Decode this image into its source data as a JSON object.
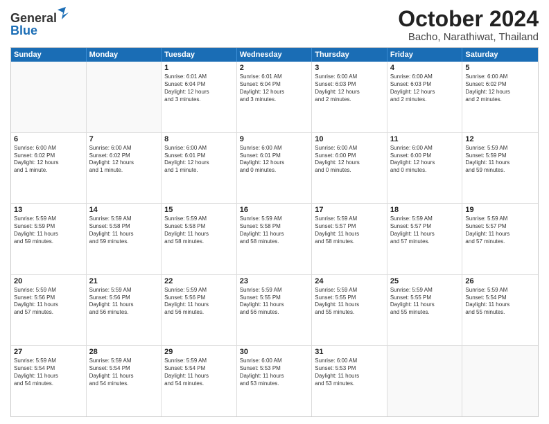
{
  "header": {
    "logo_general": "General",
    "logo_blue": "Blue",
    "title": "October 2024",
    "subtitle": "Bacho, Narathiwat, Thailand"
  },
  "days_of_week": [
    "Sunday",
    "Monday",
    "Tuesday",
    "Wednesday",
    "Thursday",
    "Friday",
    "Saturday"
  ],
  "weeks": [
    [
      {
        "day": "",
        "info": ""
      },
      {
        "day": "",
        "info": ""
      },
      {
        "day": "1",
        "info": "Sunrise: 6:01 AM\nSunset: 6:04 PM\nDaylight: 12 hours\nand 3 minutes."
      },
      {
        "day": "2",
        "info": "Sunrise: 6:01 AM\nSunset: 6:04 PM\nDaylight: 12 hours\nand 3 minutes."
      },
      {
        "day": "3",
        "info": "Sunrise: 6:00 AM\nSunset: 6:03 PM\nDaylight: 12 hours\nand 2 minutes."
      },
      {
        "day": "4",
        "info": "Sunrise: 6:00 AM\nSunset: 6:03 PM\nDaylight: 12 hours\nand 2 minutes."
      },
      {
        "day": "5",
        "info": "Sunrise: 6:00 AM\nSunset: 6:02 PM\nDaylight: 12 hours\nand 2 minutes."
      }
    ],
    [
      {
        "day": "6",
        "info": "Sunrise: 6:00 AM\nSunset: 6:02 PM\nDaylight: 12 hours\nand 1 minute."
      },
      {
        "day": "7",
        "info": "Sunrise: 6:00 AM\nSunset: 6:02 PM\nDaylight: 12 hours\nand 1 minute."
      },
      {
        "day": "8",
        "info": "Sunrise: 6:00 AM\nSunset: 6:01 PM\nDaylight: 12 hours\nand 1 minute."
      },
      {
        "day": "9",
        "info": "Sunrise: 6:00 AM\nSunset: 6:01 PM\nDaylight: 12 hours\nand 0 minutes."
      },
      {
        "day": "10",
        "info": "Sunrise: 6:00 AM\nSunset: 6:00 PM\nDaylight: 12 hours\nand 0 minutes."
      },
      {
        "day": "11",
        "info": "Sunrise: 6:00 AM\nSunset: 6:00 PM\nDaylight: 12 hours\nand 0 minutes."
      },
      {
        "day": "12",
        "info": "Sunrise: 5:59 AM\nSunset: 5:59 PM\nDaylight: 11 hours\nand 59 minutes."
      }
    ],
    [
      {
        "day": "13",
        "info": "Sunrise: 5:59 AM\nSunset: 5:59 PM\nDaylight: 11 hours\nand 59 minutes."
      },
      {
        "day": "14",
        "info": "Sunrise: 5:59 AM\nSunset: 5:58 PM\nDaylight: 11 hours\nand 59 minutes."
      },
      {
        "day": "15",
        "info": "Sunrise: 5:59 AM\nSunset: 5:58 PM\nDaylight: 11 hours\nand 58 minutes."
      },
      {
        "day": "16",
        "info": "Sunrise: 5:59 AM\nSunset: 5:58 PM\nDaylight: 11 hours\nand 58 minutes."
      },
      {
        "day": "17",
        "info": "Sunrise: 5:59 AM\nSunset: 5:57 PM\nDaylight: 11 hours\nand 58 minutes."
      },
      {
        "day": "18",
        "info": "Sunrise: 5:59 AM\nSunset: 5:57 PM\nDaylight: 11 hours\nand 57 minutes."
      },
      {
        "day": "19",
        "info": "Sunrise: 5:59 AM\nSunset: 5:57 PM\nDaylight: 11 hours\nand 57 minutes."
      }
    ],
    [
      {
        "day": "20",
        "info": "Sunrise: 5:59 AM\nSunset: 5:56 PM\nDaylight: 11 hours\nand 57 minutes."
      },
      {
        "day": "21",
        "info": "Sunrise: 5:59 AM\nSunset: 5:56 PM\nDaylight: 11 hours\nand 56 minutes."
      },
      {
        "day": "22",
        "info": "Sunrise: 5:59 AM\nSunset: 5:56 PM\nDaylight: 11 hours\nand 56 minutes."
      },
      {
        "day": "23",
        "info": "Sunrise: 5:59 AM\nSunset: 5:55 PM\nDaylight: 11 hours\nand 56 minutes."
      },
      {
        "day": "24",
        "info": "Sunrise: 5:59 AM\nSunset: 5:55 PM\nDaylight: 11 hours\nand 55 minutes."
      },
      {
        "day": "25",
        "info": "Sunrise: 5:59 AM\nSunset: 5:55 PM\nDaylight: 11 hours\nand 55 minutes."
      },
      {
        "day": "26",
        "info": "Sunrise: 5:59 AM\nSunset: 5:54 PM\nDaylight: 11 hours\nand 55 minutes."
      }
    ],
    [
      {
        "day": "27",
        "info": "Sunrise: 5:59 AM\nSunset: 5:54 PM\nDaylight: 11 hours\nand 54 minutes."
      },
      {
        "day": "28",
        "info": "Sunrise: 5:59 AM\nSunset: 5:54 PM\nDaylight: 11 hours\nand 54 minutes."
      },
      {
        "day": "29",
        "info": "Sunrise: 5:59 AM\nSunset: 5:54 PM\nDaylight: 11 hours\nand 54 minutes."
      },
      {
        "day": "30",
        "info": "Sunrise: 6:00 AM\nSunset: 5:53 PM\nDaylight: 11 hours\nand 53 minutes."
      },
      {
        "day": "31",
        "info": "Sunrise: 6:00 AM\nSunset: 5:53 PM\nDaylight: 11 hours\nand 53 minutes."
      },
      {
        "day": "",
        "info": ""
      },
      {
        "day": "",
        "info": ""
      }
    ]
  ]
}
